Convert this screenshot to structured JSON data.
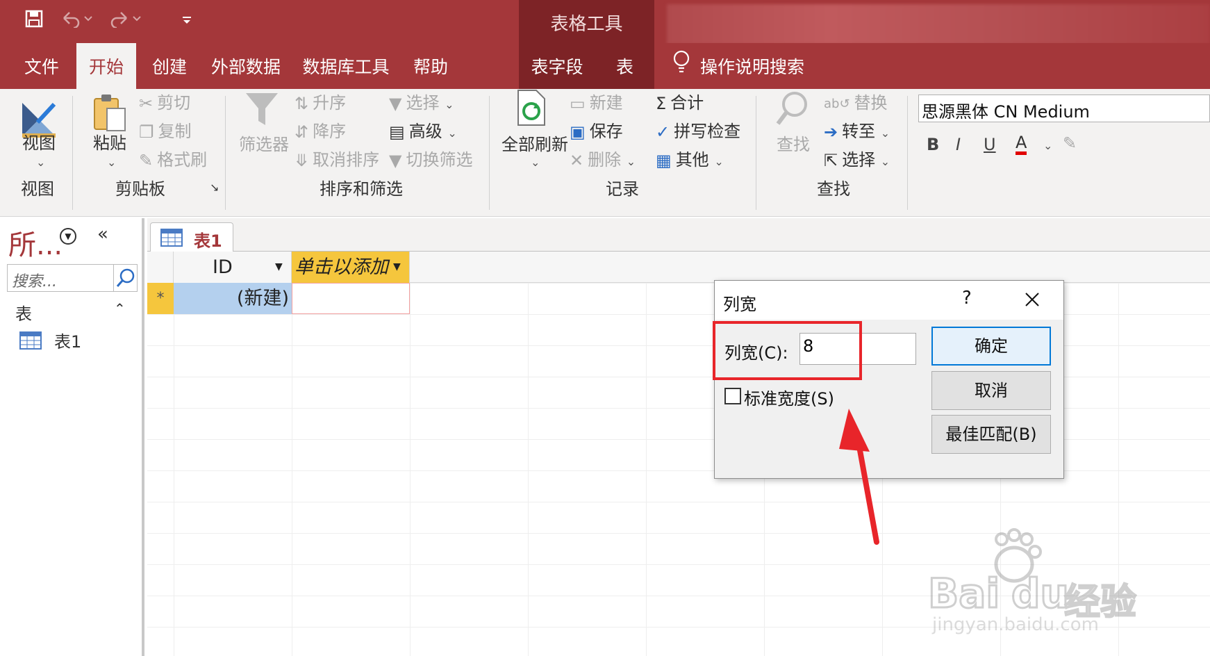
{
  "title_bar": {
    "context_title": "表格工具",
    "quick_access": [
      "save-icon",
      "undo-icon",
      "redo-icon",
      "customize-icon"
    ]
  },
  "tabs": [
    {
      "label": "文件"
    },
    {
      "label": "开始"
    },
    {
      "label": "创建"
    },
    {
      "label": "外部数据"
    },
    {
      "label": "数据库工具"
    },
    {
      "label": "帮助"
    },
    {
      "label": "表字段"
    },
    {
      "label": "表"
    }
  ],
  "tell_me": {
    "label": "操作说明搜索"
  },
  "ribbon": {
    "views": {
      "view_label": "视图",
      "group": "视图"
    },
    "clipboard": {
      "paste": "粘贴",
      "cut": "剪切",
      "copy": "复制",
      "format_painter": "格式刷",
      "group": "剪贴板"
    },
    "sort_filter": {
      "filter": "筛选器",
      "ascending": "升序",
      "descending": "降序",
      "clear_sort": "取消排序",
      "selection": "选择",
      "advanced": "高级",
      "toggle_filter": "切换筛选",
      "group": "排序和筛选"
    },
    "records": {
      "refresh_all": "全部刷新",
      "new": "新建",
      "save": "保存",
      "delete": "删除",
      "totals": "合计",
      "spelling": "拼写检查",
      "more": "其他",
      "group": "记录"
    },
    "find": {
      "find": "查找",
      "replace": "替换",
      "goto": "转至",
      "select": "选择",
      "group": "查找"
    },
    "text_format": {
      "font": "思源黑体 CN Medium",
      "bold": "B",
      "italic": "I",
      "underline": "U",
      "font_color": "A"
    }
  },
  "nav_pane": {
    "title": "所...",
    "search_placeholder": "搜索...",
    "section": "表",
    "items": [
      {
        "label": "表1"
      }
    ]
  },
  "document": {
    "tab_label": "表1",
    "columns": [
      "ID",
      "单击以添加"
    ],
    "new_row_marker": "*",
    "new_row_id": "(新建)"
  },
  "dialog": {
    "title": "列宽",
    "help": "?",
    "width_label": "列宽(C):",
    "width_value": "8",
    "standard_width_label": "标准宽度(S)",
    "standard_width_checked": false,
    "ok": "确定",
    "cancel": "取消",
    "best_fit": "最佳匹配(B)"
  },
  "watermark": {
    "brand": "Bai",
    "brand2": "du",
    "cn": "经验",
    "url": "jingyan.baidu.com"
  },
  "colors": {
    "accent": "#a4373a",
    "context": "#7d2326",
    "annotation": "#e8252a",
    "selected_row": "#b4d0ee"
  }
}
